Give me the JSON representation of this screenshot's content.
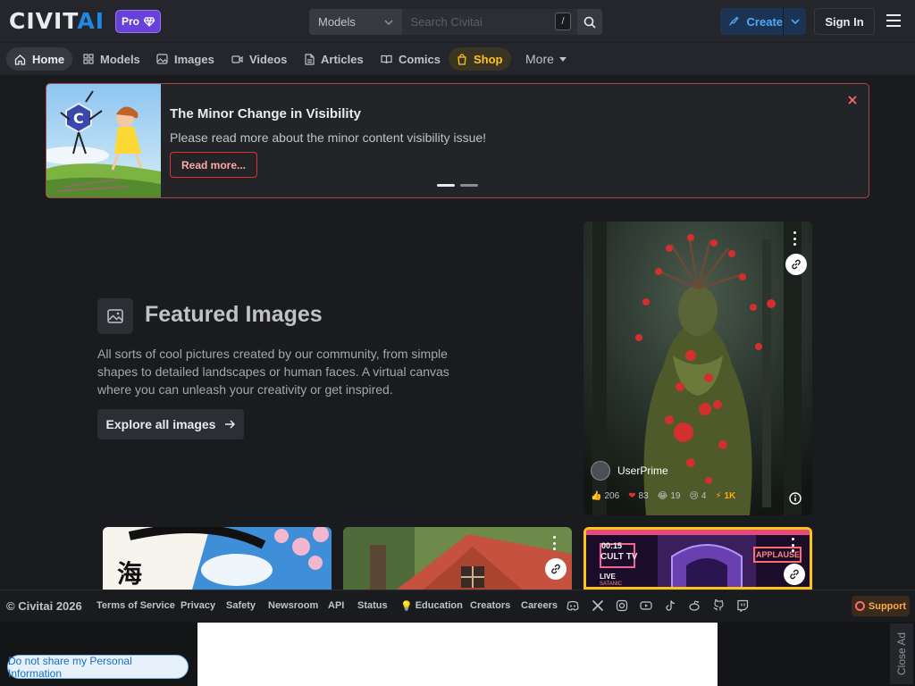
{
  "header": {
    "logo_main": "CIVIT",
    "logo_accent": "AI",
    "pro_label": "Pro",
    "search": {
      "type_label": "Models",
      "placeholder": "Search Civitai",
      "shortcut": "/"
    },
    "create_label": "Create",
    "signin_label": "Sign In"
  },
  "nav": {
    "items": [
      {
        "label": "Home",
        "icon": "home-icon"
      },
      {
        "label": "Models",
        "icon": "grid-icon"
      },
      {
        "label": "Images",
        "icon": "image-icon"
      },
      {
        "label": "Videos",
        "icon": "video-icon"
      },
      {
        "label": "Articles",
        "icon": "file-text-icon"
      },
      {
        "label": "Comics",
        "icon": "book-icon"
      },
      {
        "label": "Shop",
        "icon": "shopping-bag-icon"
      }
    ],
    "more_label": "More"
  },
  "banner": {
    "title": "The Minor Change in Visibility",
    "text": "Please read more about the minor content visibility issue!",
    "button_label": "Read more...",
    "slide_count": 2,
    "active_slide": 1
  },
  "featured": {
    "title": "Featured Images",
    "description": "All sorts of cool pictures created by our community, from simple shapes to detailed landscapes or human faces. A virtual canvas where you can unleash your creativity or get inspired.",
    "button_label": "Explore all images"
  },
  "main_card": {
    "username": "UserPrime",
    "reactions": {
      "like": "206",
      "heart": "83",
      "laugh": "19",
      "cry": "4",
      "buzz": "1K"
    }
  },
  "row_cards": [
    {
      "kind": "ink-landscape",
      "overlay_text": ""
    },
    {
      "kind": "red-roof-house",
      "overlay_text": ""
    },
    {
      "kind": "cult-tv",
      "time_label": "00:15",
      "neon_title": "CULT TV",
      "live_label": "LIVE",
      "sub_label": "SATANIC",
      "neon_sign": "APPLAUSE"
    }
  ],
  "footer": {
    "copyright": "© Civitai 2026",
    "links": [
      "Terms of Service",
      "Privacy",
      "Safety",
      "Newsroom",
      "API",
      "Status",
      "Education",
      "Creators",
      "Careers"
    ],
    "support_label": "Support"
  },
  "ad": {
    "privacy_label": "Do not share my Personal Information",
    "close_label": "Close Ad"
  },
  "colors": {
    "background": "#1a1b1e",
    "accent_blue": "#1e88e5",
    "pro_purple": "#6741d9",
    "shop_yellow": "#fcc419",
    "banner_red": "#a34848"
  }
}
